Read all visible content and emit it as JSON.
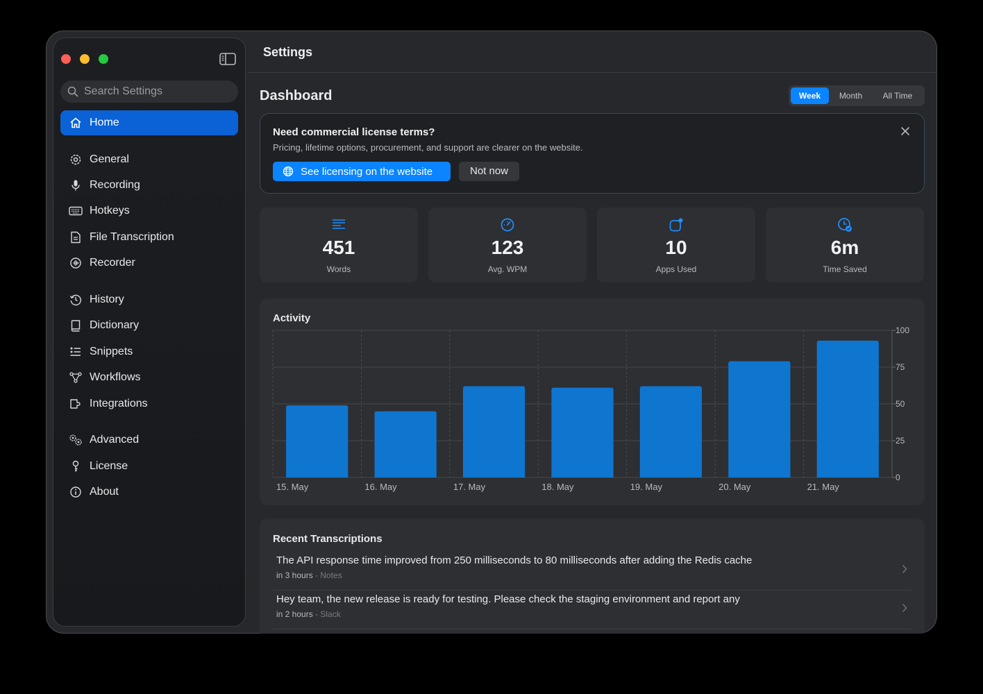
{
  "window": {
    "title": "Settings"
  },
  "sidebar": {
    "search_placeholder": "Search Settings",
    "items": [
      {
        "label": "Home",
        "icon": "home-icon",
        "active": true
      },
      {
        "label": "General",
        "icon": "gear-icon"
      },
      {
        "label": "Recording",
        "icon": "microphone-icon"
      },
      {
        "label": "Hotkeys",
        "icon": "keyboard-icon"
      },
      {
        "label": "File Transcription",
        "icon": "document-icon"
      },
      {
        "label": "Recorder",
        "icon": "waveform-circle-icon"
      },
      {
        "label": "History",
        "icon": "history-icon"
      },
      {
        "label": "Dictionary",
        "icon": "book-icon"
      },
      {
        "label": "Snippets",
        "icon": "list-icon"
      },
      {
        "label": "Workflows",
        "icon": "workflow-icon"
      },
      {
        "label": "Integrations",
        "icon": "integrations-icon"
      },
      {
        "label": "Advanced",
        "icon": "gears-icon"
      },
      {
        "label": "License",
        "icon": "key-icon"
      },
      {
        "label": "About",
        "icon": "info-icon"
      }
    ]
  },
  "dashboard": {
    "title": "Dashboard",
    "range_options": [
      "Week",
      "Month",
      "All Time"
    ],
    "selected_range": "Week"
  },
  "banner": {
    "title": "Need commercial license terms?",
    "subtitle": "Pricing, lifetime options, procurement, and support are clearer on the website.",
    "primary_label": "See licensing on the website",
    "secondary_label": "Not now"
  },
  "stats": [
    {
      "value": "451",
      "label": "Words",
      "icon": "text-lines-icon"
    },
    {
      "value": "123",
      "label": "Avg. WPM",
      "icon": "speedometer-icon"
    },
    {
      "value": "10",
      "label": "Apps Used",
      "icon": "app-badge-icon"
    },
    {
      "value": "6m",
      "label": "Time Saved",
      "icon": "clock-check-icon"
    }
  ],
  "activity": {
    "title": "Activity",
    "chart_data": {
      "type": "bar",
      "categories": [
        "15. May",
        "16. May",
        "17. May",
        "18. May",
        "19. May",
        "20. May",
        "21. May"
      ],
      "values": [
        49,
        45,
        62,
        61,
        62,
        79,
        93
      ],
      "ylim": [
        0,
        100
      ],
      "yticks": [
        0,
        25,
        50,
        75,
        100
      ],
      "grid": true,
      "color": "#0f76d0"
    }
  },
  "recent": {
    "title": "Recent Transcriptions",
    "items": [
      {
        "text": "The API response time improved from 250 milliseconds to 80 milliseconds after adding the Redis cache",
        "time": "in 3 hours",
        "app": "- Notes"
      },
      {
        "text": "Hey team, the new release is ready for testing. Please check the staging environment and report any",
        "time": "in 2 hours",
        "app": "- Slack"
      }
    ]
  }
}
